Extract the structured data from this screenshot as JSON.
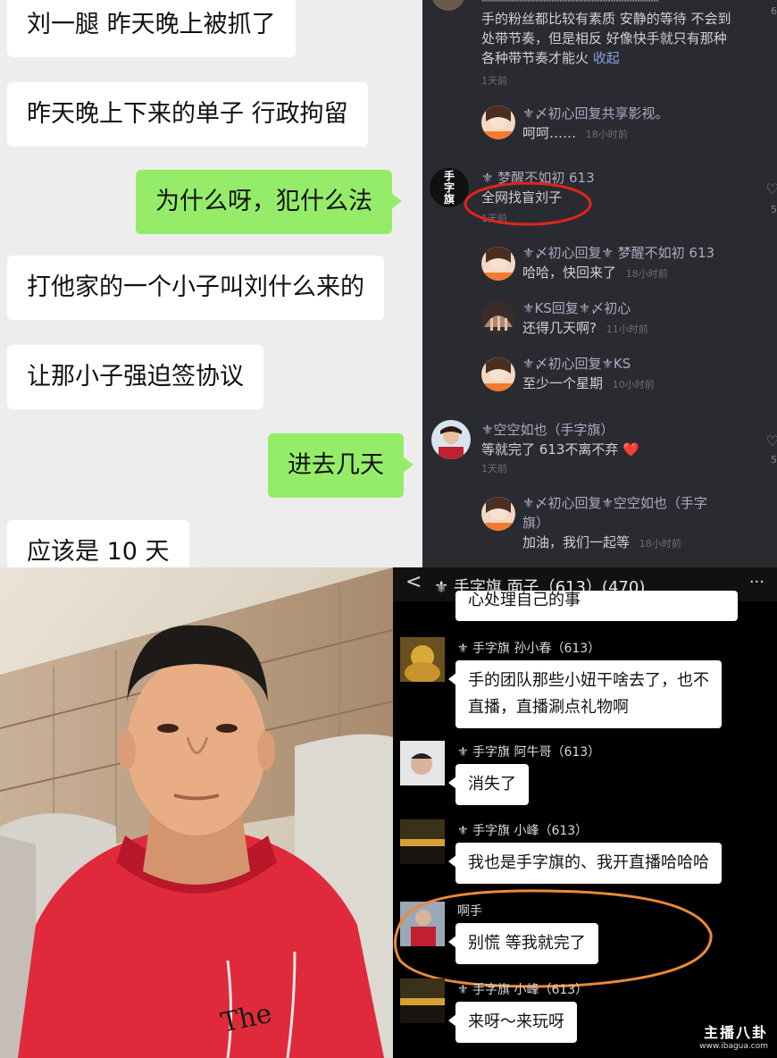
{
  "wechat": {
    "messages": [
      {
        "side": "in",
        "text": "刘一腿 昨天晚上被抓了"
      },
      {
        "side": "in",
        "text": "昨天晚上下来的单子 行政拘留"
      },
      {
        "side": "out",
        "text": "为什么呀，犯什么法"
      },
      {
        "side": "in",
        "text": "打他家的一个小子叫刘什么来的"
      },
      {
        "side": "in",
        "text": "让那小子强迫签协议"
      },
      {
        "side": "out",
        "text": "进去几天"
      },
      {
        "side": "in",
        "text": "应该是 10 天"
      }
    ]
  },
  "comments": {
    "top_snippet": [
      "手的粉丝都比较有素质 安静的等待 不会到",
      "处带节奏，但是相反 好像快手就只有那种",
      "各种带节奏才能火"
    ],
    "expand_label": "收起",
    "top_time": "1天前",
    "top_count_right": "6",
    "items": [
      {
        "name": "⚜〆初心回复共享影视。",
        "text": "呵呵……",
        "time": "18小时前"
      },
      {
        "name": "⚜ 梦醒不如初 613",
        "text": "全网找盲刘子",
        "time": "1天前",
        "avatar_label": "手字旗",
        "count": "5"
      },
      {
        "name": "⚜〆初心回复⚜ 梦醒不如初 613",
        "text": "哈哈，快回来了",
        "time": "18小时前"
      },
      {
        "name": "⚜KS回复⚜〆初心",
        "text": "还得几天啊?",
        "time": "11小时前"
      },
      {
        "name": "⚜〆初心回复⚜KS",
        "text": "至少一个星期",
        "time": "10小时前"
      },
      {
        "name": "⚜空空如也（手字旗）",
        "text": "等就完了 613不离不弃",
        "time": "1天前",
        "count": "5"
      },
      {
        "name_line1": "⚜〆初心回复⚜空空如也（手字",
        "name_line2": "旗）",
        "text": "加油，我们一起等",
        "time": "18小时前"
      }
    ],
    "heart": "❤️"
  },
  "group": {
    "back_icon": "<",
    "title": "⚜ 手字旗  面子（613）(470)",
    "more_icon": "···",
    "partial_top": "心处理自己的事",
    "messages": [
      {
        "name": "⚜ 手字旗  孙小春（613）",
        "lines": [
          "手的团队那些小妞干啥去了，也不",
          "直播，直播涮点礼物啊"
        ]
      },
      {
        "name": "⚜ 手字旗  阿牛哥（613）",
        "lines": [
          "消失了"
        ]
      },
      {
        "name": "⚜ 手字旗  小峰（613）",
        "lines": [
          "我也是手字旗的、我开直播哈哈哈"
        ]
      },
      {
        "name": "啊手",
        "lines": [
          "别慌 等我就完了"
        ]
      },
      {
        "name": "⚜ 手字旗  小峰（613）",
        "lines": [
          "来呀～来玩呀"
        ]
      }
    ],
    "watermark_main": "主播八卦",
    "watermark_url": "www.ibagua.com"
  },
  "colors": {
    "annotation_red": "#e0241e",
    "annotation_orange": "#e98a3a",
    "hoodie_red": "#e02a3c"
  }
}
